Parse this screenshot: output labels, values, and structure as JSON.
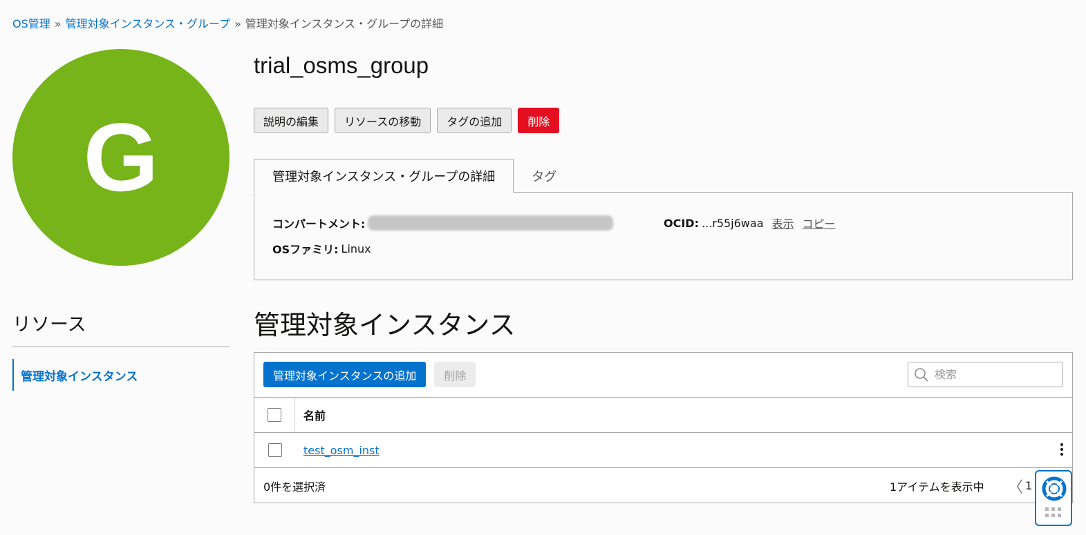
{
  "breadcrumb": {
    "items": [
      {
        "label": "OS管理",
        "link": true
      },
      {
        "label": "管理対象インスタンス・グループ",
        "link": true
      },
      {
        "label": "管理対象インスタンス・グループの詳細",
        "link": false
      }
    ],
    "separator": "»"
  },
  "avatar": {
    "letter": "G",
    "color": "#76b41a"
  },
  "title": "trial_osms_group",
  "actions": {
    "edit_description": "説明の編集",
    "move_resource": "リソースの移動",
    "add_tags": "タグの追加",
    "delete": "削除"
  },
  "tabs": [
    {
      "label": "管理対象インスタンス・グループの詳細",
      "active": true
    },
    {
      "label": "タグ",
      "active": false
    }
  ],
  "details": {
    "compartment_label": "コンパートメント:",
    "os_family_label": "OSファミリ:",
    "os_family_value": "Linux",
    "ocid_label": "OCID:",
    "ocid_value": "...r55j6waa",
    "show_link": "表示",
    "copy_link": "コピー"
  },
  "resources": {
    "heading": "リソース",
    "items": [
      {
        "label": "管理対象インスタンス",
        "active": true
      }
    ]
  },
  "section_heading": "管理対象インスタンス",
  "table": {
    "add_button": "管理対象インスタンスの追加",
    "delete_button": "削除",
    "search_placeholder": "検索",
    "column_name": "名前",
    "rows": [
      {
        "name": "test_osm_inst"
      }
    ],
    "selected_count": "0件を選択済",
    "showing": "1アイテムを表示中",
    "prev": "〈",
    "page": "1"
  },
  "colors": {
    "accent": "#0572ce",
    "danger": "#e40e21",
    "avatar": "#76b41a"
  }
}
